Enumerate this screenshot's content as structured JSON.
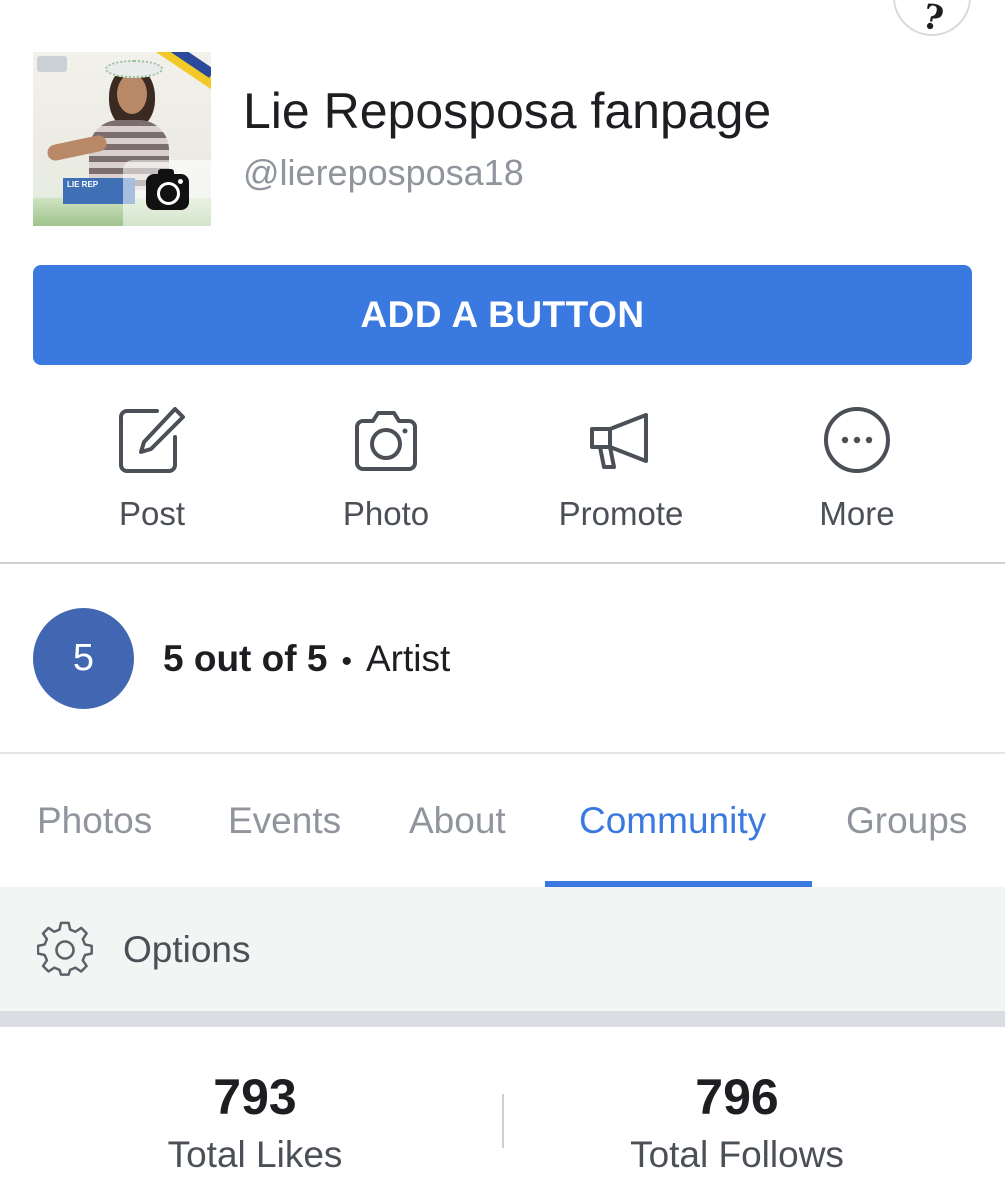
{
  "header": {
    "page_name": "Lie Reposposa fanpage",
    "handle": "@liereposposa18"
  },
  "profile_photo": {
    "badge_text": "LIE REP"
  },
  "add_button": {
    "label": "ADD A BUTTON"
  },
  "actions": [
    {
      "label": "Post",
      "icon": "edit-icon"
    },
    {
      "label": "Photo",
      "icon": "camera-icon"
    },
    {
      "label": "Promote",
      "icon": "megaphone-icon"
    },
    {
      "label": "More",
      "icon": "more-icon"
    }
  ],
  "rating": {
    "score": "5",
    "text": "5 out of 5",
    "separator": "•",
    "category": "Artist"
  },
  "tabs": [
    {
      "label": "Photos",
      "active": false
    },
    {
      "label": "Events",
      "active": false
    },
    {
      "label": "About",
      "active": false
    },
    {
      "label": "Community",
      "active": true
    },
    {
      "label": "Groups",
      "active": false
    }
  ],
  "options": {
    "label": "Options",
    "icon": "gear-icon"
  },
  "stats": [
    {
      "value": "793",
      "label": "Total Likes"
    },
    {
      "value": "796",
      "label": "Total Follows"
    }
  ],
  "colors": {
    "accent_blue": "#3a7ae0",
    "rating_circle": "#4267b2",
    "muted_text": "#90949c",
    "icon_gray": "#4b4f56"
  }
}
